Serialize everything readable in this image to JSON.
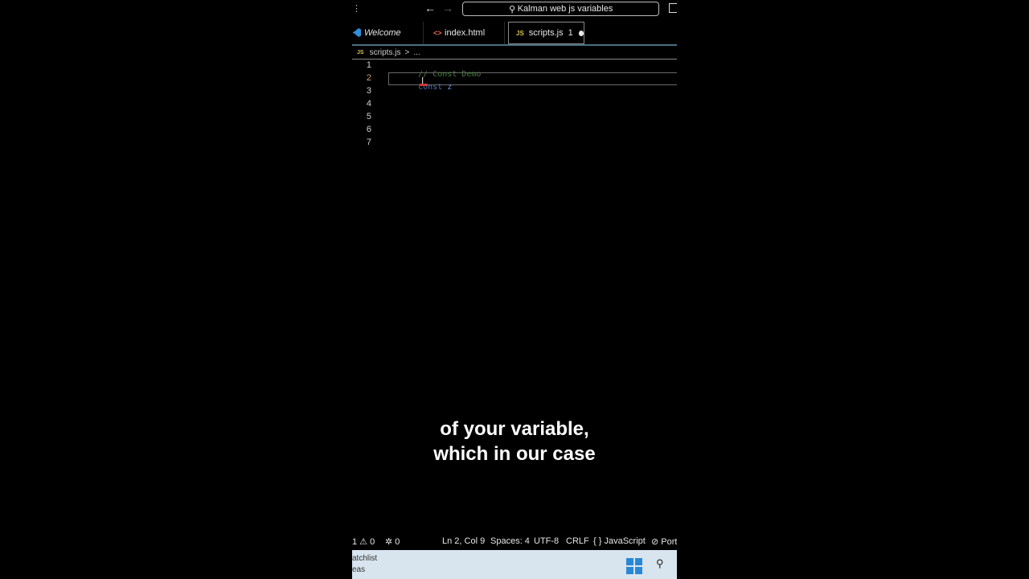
{
  "titlebar": {
    "search_text": "Kalman web js variables",
    "back_icon": "arrow-left-icon",
    "forward_icon": "arrow-right-icon"
  },
  "tabs": [
    {
      "label": "Welcome",
      "icon": "vscode-icon"
    },
    {
      "label": "index.html",
      "icon": "html-icon"
    },
    {
      "label": "scripts.js",
      "icon": "js-icon",
      "problems": "1",
      "dirty": true
    }
  ],
  "breadcrumb": {
    "file": "scripts.js",
    "sep": ">",
    "rest": "..."
  },
  "editor": {
    "js_label": "JS",
    "line_numbers": [
      "1",
      "2",
      "3",
      "4",
      "5",
      "6",
      "7"
    ],
    "lines": [
      {
        "comment": "// Const Demo"
      },
      {
        "keyword": "const",
        "identifier": "z"
      }
    ]
  },
  "caption": {
    "line1": "of your variable,",
    "line2": "which in our case"
  },
  "statusbar": {
    "errors": "1 ⚠ 0",
    "ports": "0",
    "position": "Ln 2, Col 9",
    "spaces": "Spaces: 4",
    "encoding": "UTF-8",
    "eol": "CRLF",
    "language": "JavaScript",
    "port": "Port"
  },
  "taskbar": {
    "item1": "atchlist",
    "item2": "eas"
  },
  "colors": {
    "comment": "#4a7a3e",
    "keyword": "#4e6fb0",
    "tab_underline": "#4a6f82",
    "windows_blue": "#2a87d6"
  }
}
